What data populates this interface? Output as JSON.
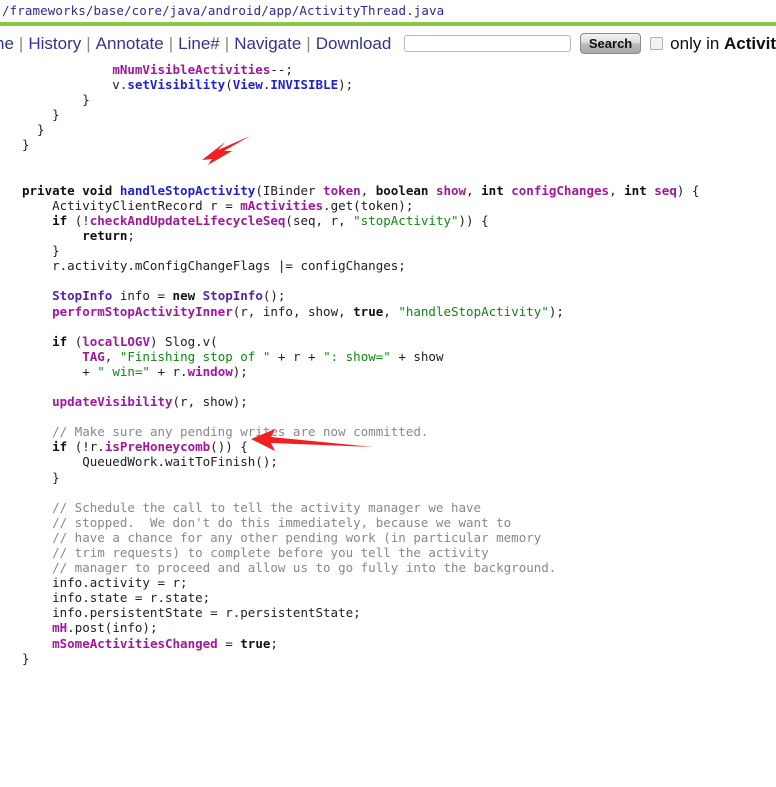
{
  "breadcrumb": {
    "path": "/frameworks/base/core/java/android/app/ActivityThread.java"
  },
  "toolbar": {
    "links": [
      {
        "label": "ne",
        "name": "nav-link-line-truncated"
      },
      {
        "label": "History",
        "name": "nav-link-history"
      },
      {
        "label": "Annotate",
        "name": "nav-link-annotate"
      },
      {
        "label": "Line#",
        "name": "nav-link-line-number"
      },
      {
        "label": "Navigate",
        "name": "nav-link-navigate"
      },
      {
        "label": "Download",
        "name": "nav-link-download"
      }
    ],
    "separator": "|",
    "search_value": "",
    "search_placeholder": "",
    "search_button_label": "Search",
    "checkbox_checked": false,
    "only_in_prefix": "only in ",
    "only_in_target": "Activit"
  },
  "colors": {
    "accent_green": "#8dc63f",
    "link": "#33338f",
    "identifier": "#a0189c",
    "keyword": "#101010",
    "string": "#118811",
    "comment": "#888888",
    "function": "#2222cc",
    "arrow_red": "#f02020"
  },
  "annotations": [
    {
      "name": "arrow-to-handle-stop-activity",
      "direction": "down-left",
      "color": "#f02020"
    },
    {
      "name": "arrow-to-queued-work-wait",
      "direction": "left",
      "color": "#f02020"
    }
  ],
  "code": {
    "language": "java",
    "lines": [
      [
        {
          "t": "plain",
          "s": "            "
        },
        {
          "t": "ident",
          "s": "mNumVisibleActivities"
        },
        {
          "t": "plain",
          "s": "--;"
        }
      ],
      [
        {
          "t": "plain",
          "s": "            v."
        },
        {
          "t": "fn",
          "s": "setVisibility"
        },
        {
          "t": "plain",
          "s": "("
        },
        {
          "t": "fn",
          "s": "View"
        },
        {
          "t": "plain",
          "s": "."
        },
        {
          "t": "fn",
          "s": "INVISIBLE"
        },
        {
          "t": "plain",
          "s": ");"
        }
      ],
      [
        {
          "t": "plain",
          "s": "        }"
        }
      ],
      [
        {
          "t": "plain",
          "s": "    }"
        }
      ],
      [
        {
          "t": "plain",
          "s": "  }"
        }
      ],
      [
        {
          "t": "plain",
          "s": "}"
        }
      ],
      [
        {
          "t": "plain",
          "s": ""
        }
      ],
      [
        {
          "t": "plain",
          "s": ""
        }
      ],
      [
        {
          "t": "kw",
          "s": "private void "
        },
        {
          "t": "fn",
          "s": "handleStopActivity"
        },
        {
          "t": "plain",
          "s": "(IBinder "
        },
        {
          "t": "ident",
          "s": "token"
        },
        {
          "t": "plain",
          "s": ", "
        },
        {
          "t": "kw",
          "s": "boolean "
        },
        {
          "t": "ident",
          "s": "show"
        },
        {
          "t": "plain",
          "s": ", "
        },
        {
          "t": "kw",
          "s": "int "
        },
        {
          "t": "ident",
          "s": "configChanges"
        },
        {
          "t": "plain",
          "s": ", "
        },
        {
          "t": "kw",
          "s": "int "
        },
        {
          "t": "ident",
          "s": "seq"
        },
        {
          "t": "plain",
          "s": ") {"
        }
      ],
      [
        {
          "t": "plain",
          "s": "    ActivityClientRecord r = "
        },
        {
          "t": "ident",
          "s": "mActivities"
        },
        {
          "t": "plain",
          "s": ".get(token);"
        }
      ],
      [
        {
          "t": "plain",
          "s": "    "
        },
        {
          "t": "kw",
          "s": "if"
        },
        {
          "t": "plain",
          "s": " (!"
        },
        {
          "t": "ident",
          "s": "checkAndUpdateLifecycleSeq"
        },
        {
          "t": "plain",
          "s": "(seq, r, "
        },
        {
          "t": "str",
          "s": "\"stopActivity\""
        },
        {
          "t": "plain",
          "s": ")) {"
        }
      ],
      [
        {
          "t": "plain",
          "s": "        "
        },
        {
          "t": "kw",
          "s": "return"
        },
        {
          "t": "plain",
          "s": ";"
        }
      ],
      [
        {
          "t": "plain",
          "s": "    }"
        }
      ],
      [
        {
          "t": "plain",
          "s": "    r.activity.mConfigChangeFlags |= configChanges;"
        }
      ],
      [
        {
          "t": "plain",
          "s": ""
        }
      ],
      [
        {
          "t": "plain",
          "s": "    "
        },
        {
          "t": "type",
          "s": "StopInfo"
        },
        {
          "t": "plain",
          "s": " info = "
        },
        {
          "t": "kw",
          "s": "new"
        },
        {
          "t": "plain",
          "s": " "
        },
        {
          "t": "type",
          "s": "StopInfo"
        },
        {
          "t": "plain",
          "s": "();"
        }
      ],
      [
        {
          "t": "plain",
          "s": "    "
        },
        {
          "t": "ident",
          "s": "performStopActivityInner"
        },
        {
          "t": "plain",
          "s": "(r, info, show, "
        },
        {
          "t": "kw",
          "s": "true"
        },
        {
          "t": "plain",
          "s": ", "
        },
        {
          "t": "str",
          "s": "\"handleStopActivity\""
        },
        {
          "t": "plain",
          "s": ");"
        }
      ],
      [
        {
          "t": "plain",
          "s": ""
        }
      ],
      [
        {
          "t": "plain",
          "s": "    "
        },
        {
          "t": "kw",
          "s": "if"
        },
        {
          "t": "plain",
          "s": " ("
        },
        {
          "t": "ident",
          "s": "localLOGV"
        },
        {
          "t": "plain",
          "s": ") Slog.v("
        }
      ],
      [
        {
          "t": "plain",
          "s": "        "
        },
        {
          "t": "ident",
          "s": "TAG"
        },
        {
          "t": "plain",
          "s": ", "
        },
        {
          "t": "str",
          "s": "\"Finishing stop of \""
        },
        {
          "t": "plain",
          "s": " + r + "
        },
        {
          "t": "str",
          "s": "\": show=\""
        },
        {
          "t": "plain",
          "s": " + show"
        }
      ],
      [
        {
          "t": "plain",
          "s": "        + "
        },
        {
          "t": "str",
          "s": "\" win=\""
        },
        {
          "t": "plain",
          "s": " + r."
        },
        {
          "t": "ident",
          "s": "window"
        },
        {
          "t": "plain",
          "s": ");"
        }
      ],
      [
        {
          "t": "plain",
          "s": ""
        }
      ],
      [
        {
          "t": "plain",
          "s": "    "
        },
        {
          "t": "ident",
          "s": "updateVisibility"
        },
        {
          "t": "plain",
          "s": "(r, show);"
        }
      ],
      [
        {
          "t": "plain",
          "s": ""
        }
      ],
      [
        {
          "t": "plain",
          "s": "    "
        },
        {
          "t": "cmt",
          "s": "// Make sure any pending writes are now committed."
        }
      ],
      [
        {
          "t": "plain",
          "s": "    "
        },
        {
          "t": "kw",
          "s": "if"
        },
        {
          "t": "plain",
          "s": " (!r."
        },
        {
          "t": "ident",
          "s": "isPreHoneycomb"
        },
        {
          "t": "plain",
          "s": "()) {"
        }
      ],
      [
        {
          "t": "plain",
          "s": "        QueuedWork.waitToFinish();"
        }
      ],
      [
        {
          "t": "plain",
          "s": "    }"
        }
      ],
      [
        {
          "t": "plain",
          "s": ""
        }
      ],
      [
        {
          "t": "plain",
          "s": "    "
        },
        {
          "t": "cmt",
          "s": "// Schedule the call to tell the activity manager we have"
        }
      ],
      [
        {
          "t": "plain",
          "s": "    "
        },
        {
          "t": "cmt",
          "s": "// stopped.  We don't do this immediately, because we want to"
        }
      ],
      [
        {
          "t": "plain",
          "s": "    "
        },
        {
          "t": "cmt",
          "s": "// have a chance for any other pending work (in particular memory"
        }
      ],
      [
        {
          "t": "plain",
          "s": "    "
        },
        {
          "t": "cmt",
          "s": "// trim requests) to complete before you tell the activity"
        }
      ],
      [
        {
          "t": "plain",
          "s": "    "
        },
        {
          "t": "cmt",
          "s": "// manager to proceed and allow us to go fully into the background."
        }
      ],
      [
        {
          "t": "plain",
          "s": "    info.activity = r;"
        }
      ],
      [
        {
          "t": "plain",
          "s": "    info.state = r.state;"
        }
      ],
      [
        {
          "t": "plain",
          "s": "    info.persistentState = r.persistentState;"
        }
      ],
      [
        {
          "t": "plain",
          "s": "    "
        },
        {
          "t": "ident",
          "s": "mH"
        },
        {
          "t": "plain",
          "s": ".post(info);"
        }
      ],
      [
        {
          "t": "plain",
          "s": "    "
        },
        {
          "t": "ident",
          "s": "mSomeActivitiesChanged"
        },
        {
          "t": "plain",
          "s": " = "
        },
        {
          "t": "kw",
          "s": "true"
        },
        {
          "t": "plain",
          "s": ";"
        }
      ],
      [
        {
          "t": "plain",
          "s": "}"
        }
      ]
    ]
  }
}
